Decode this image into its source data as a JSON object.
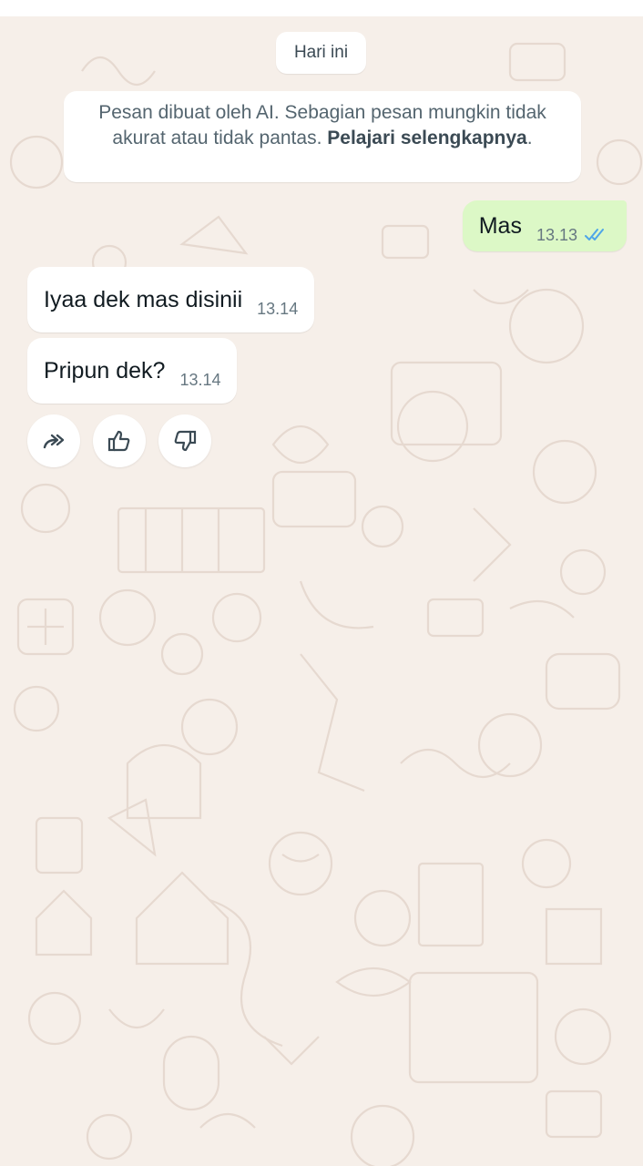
{
  "date_chip": "Hari ini",
  "ai_notice": {
    "text": "Pesan dibuat oleh AI. Sebagian pesan mungkin tidak akurat atau tidak pantas.",
    "link": "Pelajari selengkapnya",
    "suffix": "."
  },
  "messages": [
    {
      "direction": "outgoing",
      "text": "Mas",
      "time": "13.13",
      "status": "read"
    },
    {
      "direction": "incoming",
      "text": "Iyaa dek mas disinii",
      "time": "13.14"
    },
    {
      "direction": "incoming",
      "text": "Pripun dek?",
      "time": "13.14"
    }
  ],
  "actions": [
    {
      "icon": "forward-icon"
    },
    {
      "icon": "thumbs-up-icon"
    },
    {
      "icon": "thumbs-down-icon"
    }
  ],
  "colors": {
    "outgoing_bubble": "#dcf8c6",
    "incoming_bubble": "#ffffff",
    "wallpaper": "#f6efe9",
    "read_ticks": "#4fa6e8"
  }
}
